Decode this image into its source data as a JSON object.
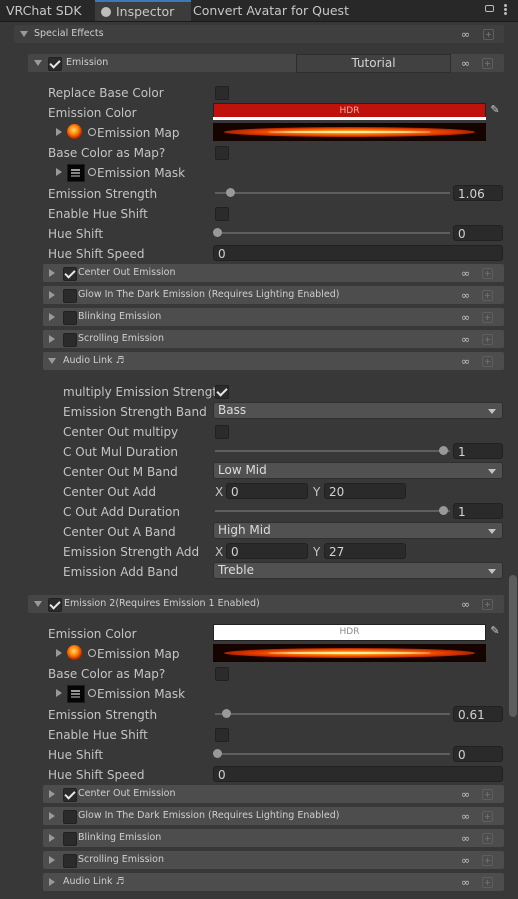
{
  "tabs": [
    "VRChat SDK",
    "Inspector",
    "Convert Avatar for Quest"
  ],
  "header_icons": [
    "lock-icon",
    "kebab-menu-icon"
  ],
  "section_title": "Special Effects",
  "emission1": {
    "title": "Emission",
    "tutorial": "Tutorial",
    "replace_base_color": "Replace Base Color",
    "emission_color": "Emission Color",
    "hdr": "HDR",
    "emission_map": "Emission Map",
    "base_color_as_map": "Base Color as Map?",
    "emission_mask": "Emission Mask",
    "emission_strength": "Emission Strength",
    "emission_strength_value": "1.06",
    "enable_hue_shift": "Enable Hue Shift",
    "hue_shift": "Hue Shift",
    "hue_shift_value": "0",
    "hue_shift_speed": "Hue Shift Speed",
    "hue_shift_speed_value": "0",
    "color_hex": "#c0120c"
  },
  "subsections1": [
    {
      "label": "Center Out Emission",
      "checked": true
    },
    {
      "label": "Glow In The Dark Emission (Requires Lighting Enabled)",
      "checked": false
    },
    {
      "label": "Blinking Emission",
      "checked": false
    },
    {
      "label": "Scrolling Emission",
      "checked": false
    }
  ],
  "audio_link": {
    "title": "Audio Link ♬",
    "multiply_emission_strength": "multiply Emission Strength",
    "emission_strength_band": "Emission Strength Band",
    "emission_strength_band_value": "Bass",
    "center_out_multipy": "Center Out multipy",
    "c_out_mul_duration": "C Out Mul Duration",
    "c_out_mul_duration_value": "1",
    "center_out_m_band": "Center Out M Band",
    "center_out_m_band_value": "Low Mid",
    "center_out_add": "Center Out Add",
    "center_out_add_x": "0",
    "center_out_add_y": "20",
    "c_out_add_duration": "C Out Add Duration",
    "c_out_add_duration_value": "1",
    "center_out_a_band": "Center Out A Band",
    "center_out_a_band_value": "High Mid",
    "emission_strength_add": "Emission Strength Add",
    "emission_strength_add_x": "0",
    "emission_strength_add_y": "27",
    "emission_add_band": "Emission Add Band",
    "emission_add_band_value": "Treble",
    "x": "X",
    "y": "Y"
  },
  "emission2": {
    "title": "Emission 2(Requires Emission 1 Enabled)",
    "emission_color": "Emission Color",
    "hdr": "HDR",
    "emission_map": "Emission Map",
    "base_color_as_map": "Base Color as Map?",
    "emission_mask": "Emission Mask",
    "emission_strength": "Emission Strength",
    "emission_strength_value": "0.61",
    "enable_hue_shift": "Enable Hue Shift",
    "hue_shift": "Hue Shift",
    "hue_shift_value": "0",
    "hue_shift_speed": "Hue Shift Speed",
    "hue_shift_speed_value": "0",
    "color_hex": "#ffffff"
  },
  "subsections2": [
    {
      "label": "Center Out Emission",
      "checked": true
    },
    {
      "label": "Glow In The Dark Emission (Requires Lighting Enabled)",
      "checked": false
    },
    {
      "label": "Blinking Emission",
      "checked": false
    },
    {
      "label": "Scrolling Emission",
      "checked": false
    },
    {
      "label": "Audio Link ♬"
    }
  ]
}
